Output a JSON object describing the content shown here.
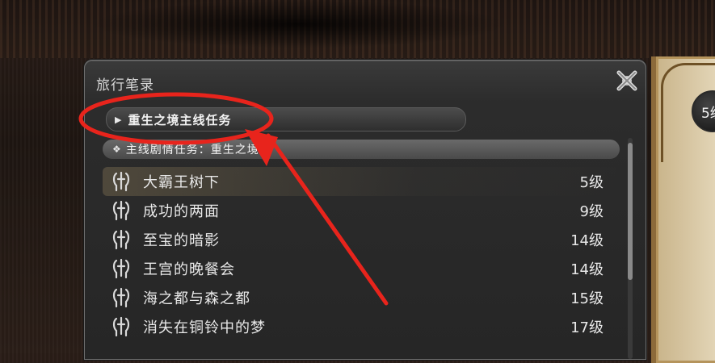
{
  "window": {
    "title": "旅行笔录"
  },
  "category": {
    "label": "重生之境主线任务"
  },
  "section": {
    "label": "主线剧情任务：重生之境"
  },
  "quests": [
    {
      "name": "大霸王树下",
      "level": "5级",
      "selected": true
    },
    {
      "name": "成功的两面",
      "level": "9级"
    },
    {
      "name": "至宝的暗影",
      "level": "14级"
    },
    {
      "name": "王宫的晚餐会",
      "level": "14级"
    },
    {
      "name": "海之都与森之都",
      "level": "15级"
    },
    {
      "name": "消失在铜铃中的梦",
      "level": "17级"
    }
  ],
  "side_panel": {
    "level_text": "5级"
  },
  "colors": {
    "annotation": "#e8241c",
    "window_bg": "#262626",
    "text": "#e8e8e8"
  },
  "icons": {
    "close": "close-x-icon",
    "quest": "main-scenario-quest-icon",
    "collapse": "triangle-right-icon",
    "section": "diamond-cluster-icon"
  }
}
